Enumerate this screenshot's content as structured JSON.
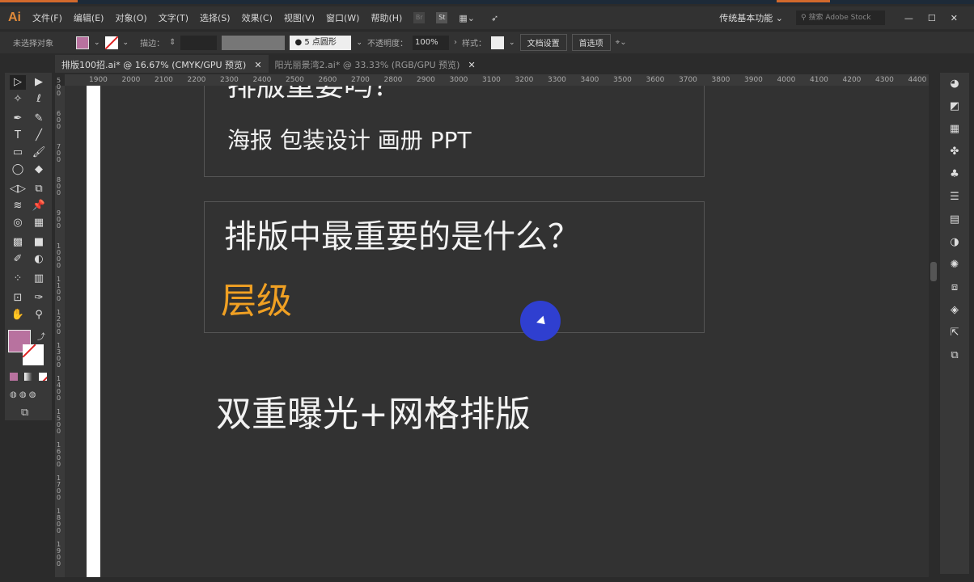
{
  "app": {
    "logo": "Ai",
    "menu": [
      "文件(F)",
      "编辑(E)",
      "对象(O)",
      "文字(T)",
      "选择(S)",
      "效果(C)",
      "视图(V)",
      "窗口(W)",
      "帮助(H)"
    ],
    "bridge": "Br",
    "stock": "St",
    "workspace": "传统基本功能 ⌄",
    "search_placeholder": "搜索 Adobe Stock",
    "window_buttons": [
      "—",
      "☐",
      "✕"
    ]
  },
  "control": {
    "selection": "未选择对象",
    "fill_color": "#b8729f",
    "stroke_label": "描边：",
    "brush": "● 5 点圆形",
    "opacity_label": "不透明度：",
    "opacity": "100%",
    "style_label": "样式：",
    "doc_setup": "文档设置",
    "prefs": "首选项"
  },
  "tabs": [
    {
      "label": "排版100招.ai* @ 16.67% (CMYK/GPU 预览)",
      "close": "✕"
    },
    {
      "label": "阳光丽景湾2.ai* @ 33.33% (RGB/GPU 预览)",
      "close": "✕"
    }
  ],
  "hruler": [
    "1900",
    "2000",
    "2100",
    "2200",
    "2300",
    "2400",
    "2500",
    "2600",
    "2700",
    "2800",
    "2900",
    "3000",
    "3100",
    "3200",
    "3300",
    "3400",
    "3500",
    "3600",
    "3700",
    "3800",
    "3900",
    "4000",
    "4100",
    "4200",
    "4300",
    "4400"
  ],
  "vruler": [
    "500",
    "600",
    "700",
    "800",
    "900",
    "1000",
    "1100",
    "1200",
    "1300",
    "1400",
    "1500",
    "1600",
    "1700",
    "1800",
    "1900"
  ],
  "artboard": {
    "title1": "排版重要吗？",
    "subtitle1": "海报 包装设计 画册  PPT",
    "title2": "排版中最重要的是什么？",
    "answer": "层级",
    "answer_color": "#f0a023",
    "title3": "双重曝光+网格排版"
  }
}
